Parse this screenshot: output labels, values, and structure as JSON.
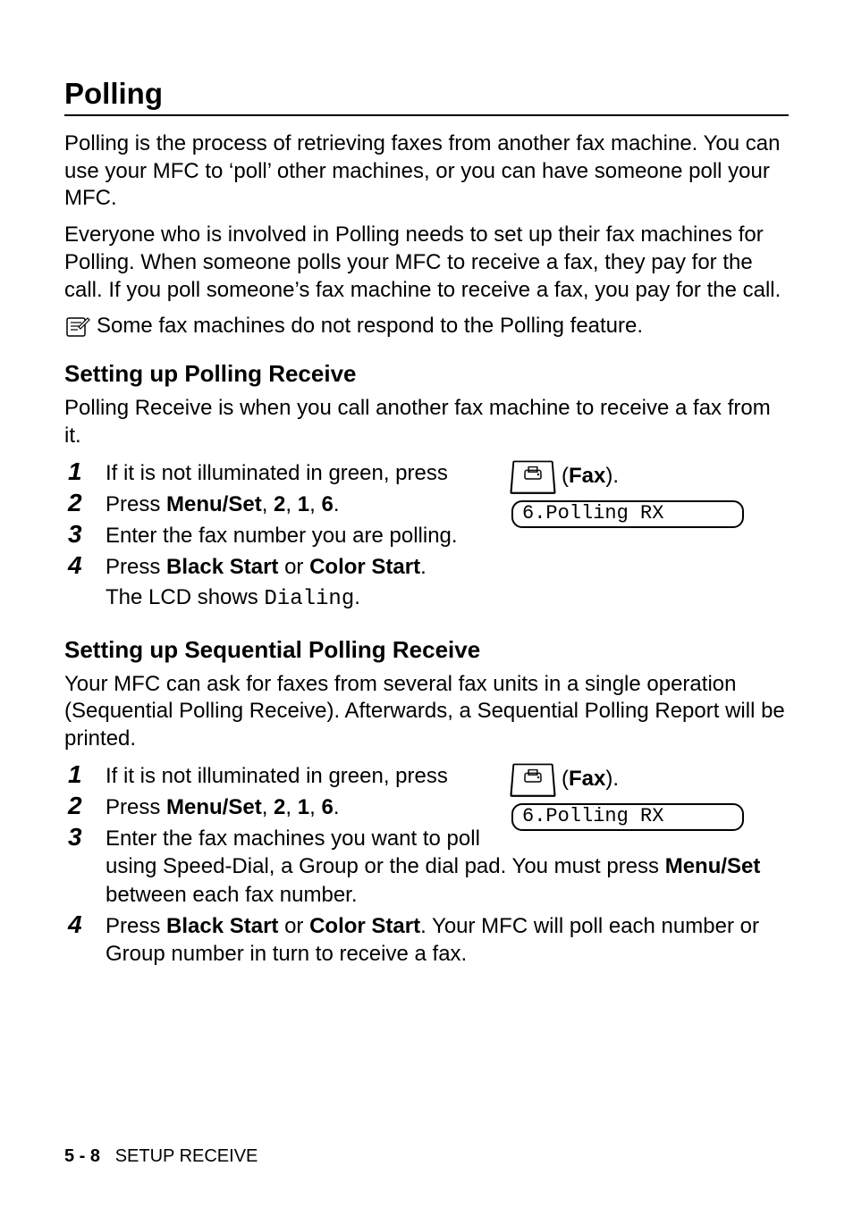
{
  "heading": "Polling",
  "intro1": "Polling is the process of retrieving faxes from another fax machine. You can use your MFC to ‘poll’ other machines, or you can have someone poll your MFC.",
  "intro2": "Everyone who is involved in Polling needs to set up their fax machines for Polling. When someone polls your MFC to receive a fax, they pay for the call. If you poll someone’s fax machine to receive a fax, you pay for the call.",
  "note": "Some fax machines do not respond to the Polling feature.",
  "section1": {
    "title": "Setting up Polling Receive",
    "intro": "Polling Receive is when you call another fax machine to receive a fax from it.",
    "fax_button_label": "Fax",
    "lcd": "6.Polling RX",
    "step1_pre": "If it is not illuminated in green, press ",
    "step1_post": ").",
    "step2_pre": "Press ",
    "step2_menu": "Menu/Set",
    "step2_keys": ", 2, 1, 6.",
    "step2_k_2": "2",
    "step2_k_1": "1",
    "step2_k_6": "6",
    "step2_sep": ", ",
    "step2_end": ".",
    "step3": "Enter the fax number you are polling.",
    "step4_pre": "Press ",
    "step4_b1": "Black Start",
    "step4_or": " or ",
    "step4_b2": "Color Start",
    "step4_end": ".",
    "step4_sub_pre": "The LCD shows ",
    "step4_sub_mono": "Dialing",
    "step4_sub_end": "."
  },
  "section2": {
    "title": "Setting up Sequential Polling Receive",
    "intro": "Your MFC can ask for faxes from several fax units in a single operation (Sequential Polling Receive). Afterwards, a Sequential Polling Report will be printed.",
    "fax_button_label": "Fax",
    "lcd": "6.Polling RX",
    "step1_pre": "If it is not illuminated in green, press ",
    "step1_post": ").",
    "step2_pre": "Press ",
    "step2_menu": "Menu/Set",
    "step2_k_2": "2",
    "step2_k_1": "1",
    "step2_k_6": "6",
    "step2_sep": ", ",
    "step2_end": ".",
    "step3_pre": "Enter the fax machines you want to poll using Speed-Dial, a Group or the dial pad. You must press ",
    "step3_menu": "Menu/Set",
    "step3_post": " between each fax number.",
    "step4_pre": "Press ",
    "step4_b1": "Black Start",
    "step4_or": " or ",
    "step4_b2": "Color Start",
    "step4_mid": ". Your MFC will poll each number or Group number in turn to receive a fax."
  },
  "footer": {
    "page": "5 - 8",
    "section": "SETUP RECEIVE"
  },
  "nums": {
    "n1": "1",
    "n2": "2",
    "n3": "3",
    "n4": "4"
  }
}
